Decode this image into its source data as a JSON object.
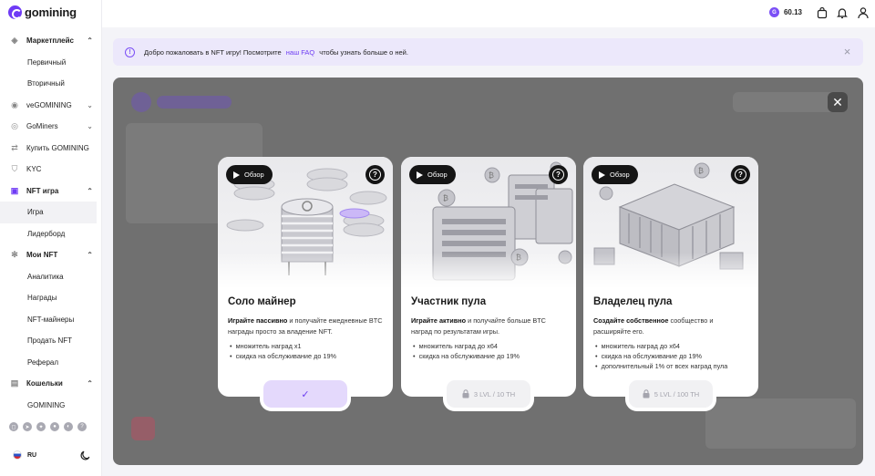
{
  "app": {
    "logo_text": "gomining"
  },
  "sidebar": {
    "items": [
      {
        "label": "Маркетплейс",
        "type": "parent",
        "icon": "tag-icon",
        "chevron": "up"
      },
      {
        "label": "Первичный",
        "type": "child"
      },
      {
        "label": "Вторичный",
        "type": "child"
      },
      {
        "label": "veGOMINING",
        "type": "parent",
        "icon": "coin-icon",
        "chevron": "down"
      },
      {
        "label": "GoMiners",
        "type": "parent",
        "icon": "users-icon",
        "chevron": "down"
      },
      {
        "label": "Купить GOMINING",
        "type": "parent",
        "icon": "exchange-icon",
        "chevron": ""
      },
      {
        "label": "KYC",
        "type": "parent",
        "icon": "shield-icon",
        "chevron": ""
      },
      {
        "label": "NFT игра",
        "type": "parent",
        "icon": "gamepad-icon",
        "chevron": "up"
      },
      {
        "label": "Игра",
        "type": "child",
        "active": true
      },
      {
        "label": "Лидерборд",
        "type": "child"
      },
      {
        "label": "Мои NFT",
        "type": "parent",
        "icon": "gear-icon",
        "chevron": "up"
      },
      {
        "label": "Аналитика",
        "type": "child"
      },
      {
        "label": "Награды",
        "type": "child"
      },
      {
        "label": "NFT-майнеры",
        "type": "child"
      },
      {
        "label": "Продать NFT",
        "type": "child"
      },
      {
        "label": "Реферал",
        "type": "child"
      },
      {
        "label": "Кошельки",
        "type": "parent",
        "icon": "wallet-icon",
        "chevron": "up"
      },
      {
        "label": "GOMINING",
        "type": "child"
      }
    ],
    "socials": [
      "instagram-icon",
      "telegram-icon",
      "twitter-icon",
      "discord-icon",
      "reddit-icon",
      "help-icon"
    ],
    "language": "RU"
  },
  "header": {
    "balance": "60.13"
  },
  "banner": {
    "text_before": "Добро пожаловать в NFT игру! Посмотрите",
    "link": "наш FAQ",
    "text_after": "чтобы узнать больше о ней."
  },
  "cards": [
    {
      "review_label": "Обзор",
      "title": "Соло майнер",
      "desc_bold": "Играйте пассивно",
      "desc_rest": " и получайте ежедневные BTC награды просто за владение NFT.",
      "bullets": [
        "множитель наград x1",
        "скидка на обслуживание до 19%"
      ],
      "action": {
        "state": "selected",
        "label": "✓"
      }
    },
    {
      "review_label": "Обзор",
      "title": "Участник пула",
      "desc_bold": "Играйте активно",
      "desc_rest": " и получайте больше BTC наград по результатам игры.",
      "bullets": [
        "множитель наград до x64",
        "скидка на обслуживание до 19%"
      ],
      "action": {
        "state": "locked",
        "label": "3 LVL / 10 TH"
      }
    },
    {
      "review_label": "Обзор",
      "title": "Владелец пула",
      "desc_bold": "Создайте собственное",
      "desc_rest": " сообщество и расширяйте его.",
      "bullets": [
        "множитель наград до x64",
        "скидка на обслуживание до 19%",
        "дополнительный 1% от всех наград пула"
      ],
      "action": {
        "state": "locked",
        "label": "5 LVL / 100 TH"
      }
    }
  ],
  "colors": {
    "accent": "#6f3bf5",
    "banner_bg": "#ece8fb",
    "overlay": "#707070"
  }
}
